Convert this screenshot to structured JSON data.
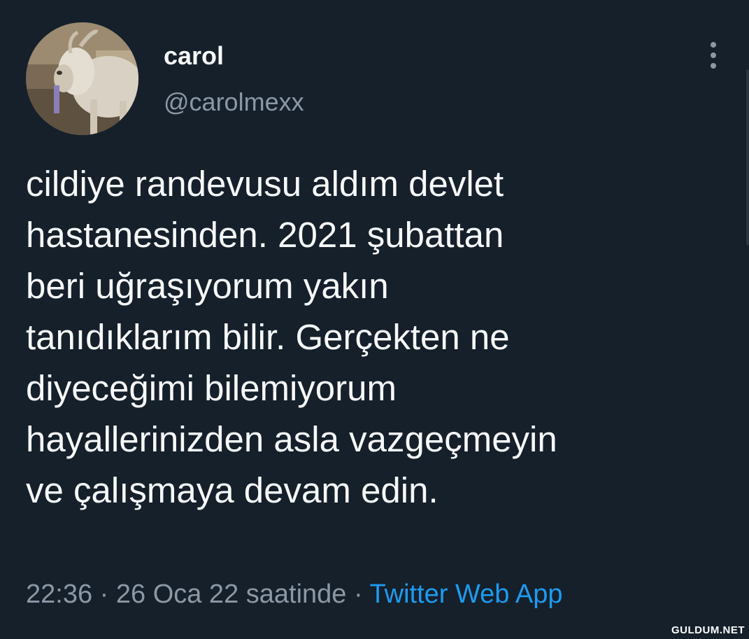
{
  "tweet": {
    "author": {
      "display_name": "carol",
      "handle": "@carolmexx",
      "avatar_icon": "goat-avatar"
    },
    "more_icon": "more-vertical-icon",
    "text_lines": [
      "cildiye randevusu aldım devlet",
      "hastanesinden. 2021 şubattan",
      "beri uğraşıyorum yakın",
      "tanıdıklarım bilir. Gerçekten ne",
      "diyeceğimi bilemiyorum",
      "hayallerinizden asla vazgeçmeyin",
      "ve çalışmaya devam edin."
    ],
    "meta": {
      "timestamp": "22:36 · 26 Oca 22 saatinde",
      "separator": " · ",
      "source": "Twitter Web App"
    }
  },
  "watermark": "GULDUM.NET",
  "colors": {
    "background": "#15202b",
    "primary_text": "#f7f9f9",
    "secondary_text": "#8b98a5",
    "link": "#1d9bf0"
  }
}
